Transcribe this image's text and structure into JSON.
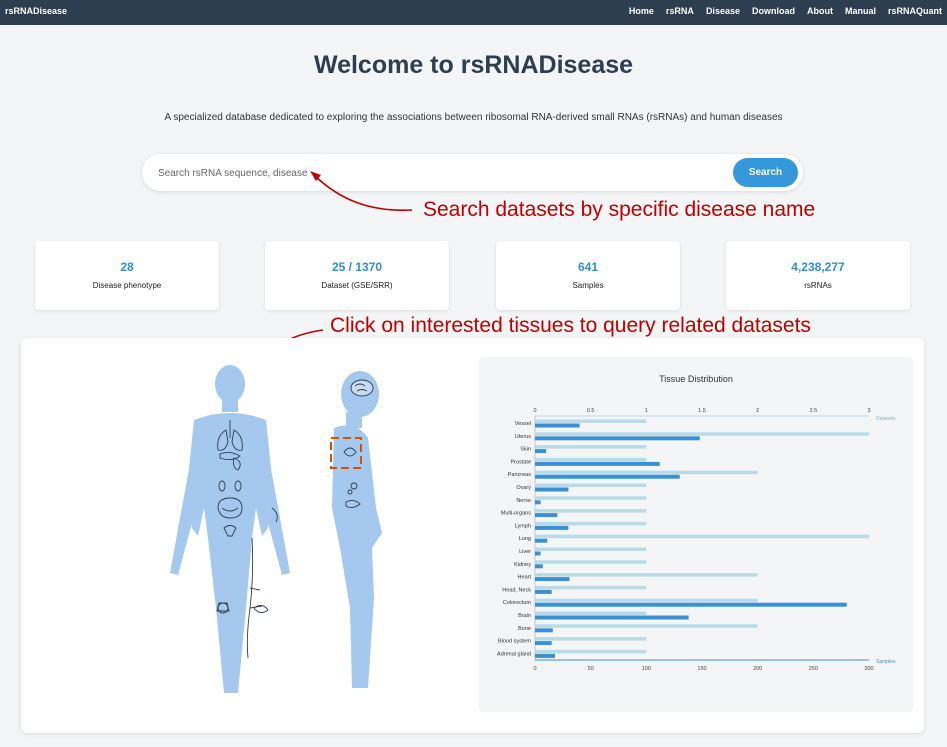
{
  "nav": {
    "brand": "rsRNADisease",
    "items": [
      {
        "label": "Home"
      },
      {
        "label": "rsRNA"
      },
      {
        "label": "Disease"
      },
      {
        "label": "Download"
      },
      {
        "label": "About"
      },
      {
        "label": "Manual"
      },
      {
        "label": "rsRNAQuant"
      }
    ]
  },
  "header": {
    "title": "Welcome to rsRNADisease",
    "subtitle": "A specialized database dedicated to exploring the associations between ribosomal RNA-derived small RNAs (rsRNAs) and human diseases"
  },
  "search": {
    "placeholder": "Search rsRNA sequence, disease",
    "button_label": "Search"
  },
  "annotations": {
    "search_hint": "Search datasets by specific disease name",
    "tissue_hint": "Click on interested tissues to query related datasets"
  },
  "stats": [
    {
      "value": "28",
      "label": "Disease phenotype"
    },
    {
      "value": "25 / 1370",
      "label": "Dataset (GSE/SRR)"
    },
    {
      "value": "641",
      "label": "Samples"
    },
    {
      "value": "4,238,277",
      "label": "rsRNAs"
    }
  ],
  "colors": {
    "nav_bg": "#2c3e50",
    "accent": "#3498db",
    "annotation": "#c00000",
    "datasets_bar": "#b9dbe6",
    "samples_bar": "#3b8fd3",
    "body_fill": "#a5c8ef"
  },
  "icons": [
    "brain-icon",
    "lungs-icon",
    "heart-icon",
    "liver-icon",
    "stomach-icon",
    "colon-icon",
    "kidney-icon",
    "uterus-icon",
    "bone-icon",
    "nerve-icon",
    "lymph-icon"
  ],
  "chart_data": {
    "type": "bar",
    "orientation": "horizontal",
    "title": "Tissue Distribution",
    "categories": [
      "Vessel",
      "Uterus",
      "Skin",
      "Prostate",
      "Pancreas",
      "Ovary",
      "Nerve",
      "Multi-organs",
      "Lymph",
      "Lung",
      "Liver",
      "Kidney",
      "Heart",
      "Head, Neck",
      "Colorectum",
      "Brain",
      "Bone",
      "Blood system",
      "Adrenal gland"
    ],
    "series": [
      {
        "name": "Datasets",
        "axis": "top",
        "values": [
          1,
          3,
          1,
          1,
          2,
          1,
          1,
          1,
          1,
          3,
          1,
          1,
          2,
          1,
          2,
          1,
          2,
          1,
          1
        ]
      },
      {
        "name": "Samples",
        "axis": "bottom",
        "values": [
          40,
          148,
          10,
          112,
          130,
          30,
          5,
          20,
          30,
          11,
          5,
          7,
          31,
          15,
          280,
          138,
          16,
          15,
          18
        ]
      }
    ],
    "top_axis": {
      "range": [
        0,
        3
      ],
      "ticks": [
        "0",
        "0.5",
        "1",
        "1.5",
        "2",
        "2.5",
        "3"
      ]
    },
    "bottom_axis": {
      "range": [
        0,
        300
      ],
      "ticks": [
        "0",
        "50",
        "100",
        "150",
        "200",
        "250",
        "300"
      ]
    },
    "grid": false
  }
}
